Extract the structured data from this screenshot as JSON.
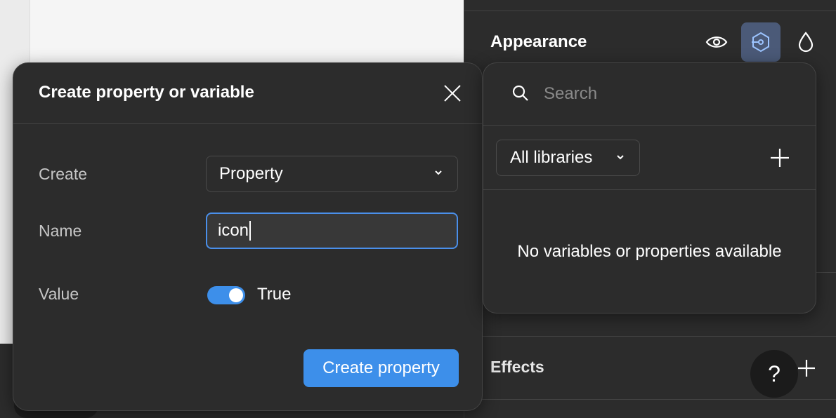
{
  "panel": {
    "appearance_title": "Appearance",
    "effects_title": "Effects",
    "help_label": "?"
  },
  "dialog": {
    "title": "Create property or variable",
    "create_label": "Create",
    "create_value": "Property",
    "name_label": "Name",
    "name_value": "icon",
    "value_label": "Value",
    "toggle_on": true,
    "toggle_label": "True",
    "submit_label": "Create property"
  },
  "library_popover": {
    "search_placeholder": "Search",
    "library_filter": "All libraries",
    "empty_message": "No variables or properties available"
  },
  "colors": {
    "accent": "#3d8fea",
    "panel_bg": "#2c2c2c",
    "active_icon_bg": "#4b5a78",
    "canvas_bg": "#f5f5f5"
  },
  "icons": [
    "eye-icon",
    "variable-icon",
    "drop-icon",
    "close-icon",
    "chevron-down-icon",
    "search-icon",
    "plus-icon"
  ]
}
